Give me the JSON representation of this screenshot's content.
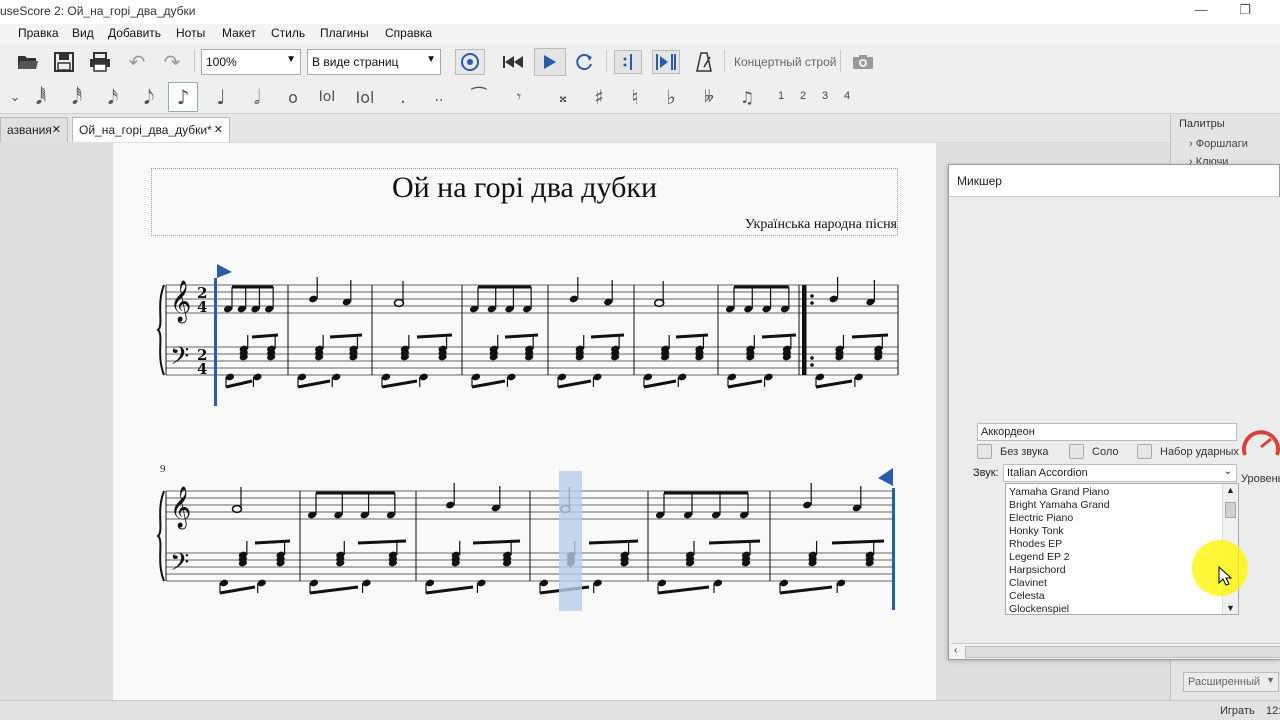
{
  "window": {
    "title": "useScore 2: Ой_на_горі_два_дубки"
  },
  "menu": [
    "Правка",
    "Вид",
    "Добавить",
    "Ноты",
    "Макет",
    "Стиль",
    "Плагины",
    "Справка"
  ],
  "toolbar": {
    "zoom": "100%",
    "view_mode": "В виде страниц",
    "concert_pitch": "Концертный строй"
  },
  "voices": [
    "1",
    "2",
    "3",
    "4"
  ],
  "tabs": [
    {
      "label": "азвания"
    },
    {
      "label": "Ой_на_горі_два_дубки*"
    }
  ],
  "score": {
    "title": "Ой на горі два дубки",
    "subtitle": "Українська народна пісня",
    "system2_number": "9"
  },
  "palette": {
    "header": "Палитры",
    "items": [
      "Форшлаги",
      "Ключи"
    ],
    "mode": "Расширенный"
  },
  "mixer": {
    "title": "Микшер",
    "instrument_name": "Аккордеон",
    "mute_label": "Без звука",
    "solo_label": "Соло",
    "drumset_label": "Набор ударных",
    "sound_label": "Звук:",
    "sound_value": "Italian Accordion",
    "level_label": "Уровень",
    "sound_options": [
      "Yamaha Grand Piano",
      "Bright Yamaha Grand",
      "Electric Piano",
      "Honky Tonk",
      "Rhodes EP",
      "Legend EP 2",
      "Harpsichord",
      "Clavinet",
      "Celesta",
      "Glockenspiel"
    ]
  },
  "status": {
    "play": "Играть",
    "time": "12:"
  },
  "colors": {
    "accent": "#2a5caa",
    "selection": "#b9cbe8",
    "level_knob": "#d9413a"
  }
}
